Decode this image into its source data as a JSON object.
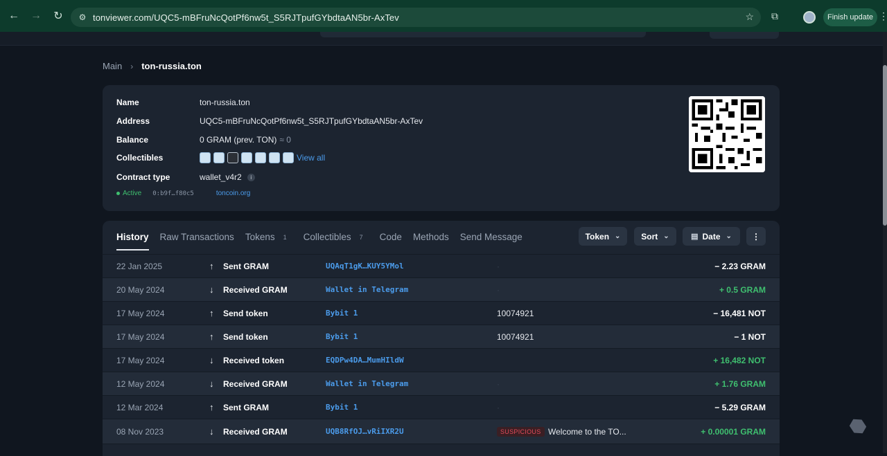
{
  "browser": {
    "url": "tonviewer.com/UQC5-mBFruNcQotPf6nw5t_S5RJTpufGYbdtaAN5br-AxTev",
    "finish_update": "Finish update"
  },
  "breadcrumb": {
    "main": "Main",
    "current": "ton-russia.ton"
  },
  "account": {
    "name_label": "Name",
    "name": "ton-russia.ton",
    "address_label": "Address",
    "address": "UQC5-mBFruNcQotPf6nw5t_S5RJTpufGYbdtaAN5br-AxTev",
    "balance_label": "Balance",
    "balance": "0 GRAM (prev. TON)",
    "balance_approx": "≈ 0",
    "collectibles_label": "Collectibles",
    "view_all": "View all",
    "contract_label": "Contract type",
    "contract": "wallet_v4r2",
    "status": "Active",
    "hash": "0:b9f…f80c5",
    "link": "toncoin.org"
  },
  "tabs": [
    {
      "label": "History",
      "count": ""
    },
    {
      "label": "Raw Transactions",
      "count": ""
    },
    {
      "label": "Tokens",
      "count": "1"
    },
    {
      "label": "Collectibles",
      "count": "7"
    },
    {
      "label": "Code",
      "count": ""
    },
    {
      "label": "Methods",
      "count": ""
    },
    {
      "label": "Send Message",
      "count": ""
    }
  ],
  "controls": {
    "token": "Token",
    "sort": "Sort",
    "date": "Date"
  },
  "transactions": [
    {
      "date": "22 Jan 2025",
      "dir": "↑",
      "action": "Sent GRAM",
      "addr": "UQAqT1gK…KUY5YMol",
      "comment": "",
      "amount": "− 2.23 GRAM",
      "positive": false
    },
    {
      "date": "20 May 2024",
      "dir": "↓",
      "action": "Received GRAM",
      "addr": "Wallet in Telegram",
      "comment": "",
      "amount": "+ 0.5 GRAM",
      "positive": true
    },
    {
      "date": "17 May 2024",
      "dir": "↑",
      "action": "Send token",
      "addr": "Bybit 1",
      "comment": "10074921",
      "amount": "− 16,481 NOT",
      "positive": false
    },
    {
      "date": "17 May 2024",
      "dir": "↑",
      "action": "Send token",
      "addr": "Bybit 1",
      "comment": "10074921",
      "amount": "− 1 NOT",
      "positive": false
    },
    {
      "date": "17 May 2024",
      "dir": "↓",
      "action": "Received token",
      "addr": "EQDPw4DA…MumHIldW",
      "comment": "",
      "amount": "+ 16,482 NOT",
      "positive": true
    },
    {
      "date": "12 May 2024",
      "dir": "↓",
      "action": "Received GRAM",
      "addr": "Wallet in Telegram",
      "comment": "",
      "amount": "+ 1.76 GRAM",
      "positive": true
    },
    {
      "date": "12 Mar 2024",
      "dir": "↑",
      "action": "Sent GRAM",
      "addr": "Bybit 1",
      "comment": "",
      "amount": "− 5.29 GRAM",
      "positive": false
    },
    {
      "date": "08 Nov 2023",
      "dir": "↓",
      "action": "Received GRAM",
      "addr": "UQB8RfOJ…vRiIXR2U",
      "badge": "SUSPICIOUS",
      "comment": "Welcome to the TO...",
      "amount": "+ 0.00001 GRAM",
      "positive": true
    }
  ]
}
